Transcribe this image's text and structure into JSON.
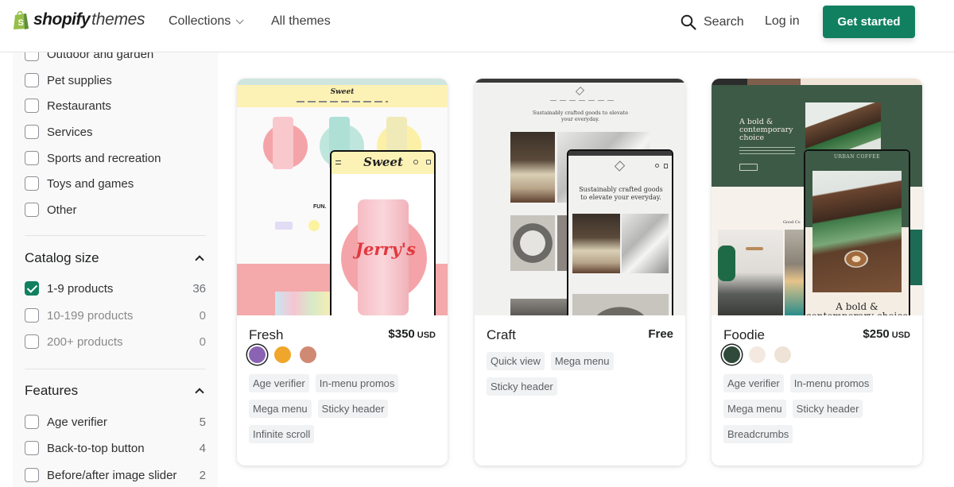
{
  "header": {
    "logo": {
      "bold": "shopify",
      "light": "themes"
    },
    "nav": [
      {
        "label": "Collections",
        "has_dropdown": true
      },
      {
        "label": "All themes"
      }
    ],
    "search_label": "Search",
    "login_label": "Log in",
    "cta_label": "Get started",
    "colors": {
      "accent": "#118060",
      "logo_green": "#95bf47"
    }
  },
  "sidebar": {
    "industry_items": [
      {
        "label": "Outdoor and garden",
        "checked": false
      },
      {
        "label": "Pet supplies",
        "checked": false
      },
      {
        "label": "Restaurants",
        "checked": false
      },
      {
        "label": "Services",
        "checked": false
      },
      {
        "label": "Sports and recreation",
        "checked": false
      },
      {
        "label": "Toys and games",
        "checked": false
      },
      {
        "label": "Other",
        "checked": false
      }
    ],
    "catalog_size": {
      "title": "Catalog size",
      "expanded": true,
      "items": [
        {
          "label": "1-9 products",
          "count": "36",
          "checked": true
        },
        {
          "label": "10-199 products",
          "count": "0",
          "checked": false
        },
        {
          "label": "200+ products",
          "count": "0",
          "checked": false
        }
      ]
    },
    "features": {
      "title": "Features",
      "expanded": true,
      "items": [
        {
          "label": "Age verifier",
          "count": "5",
          "checked": false
        },
        {
          "label": "Back-to-top button",
          "count": "4",
          "checked": false
        },
        {
          "label": "Before/after image slider",
          "count": "2",
          "checked": false
        }
      ]
    }
  },
  "themes": [
    {
      "name": "Fresh",
      "price": "$350",
      "currency": "USD",
      "swatches": [
        "#8a63b5",
        "#f0a62b",
        "#d08a73"
      ],
      "selected_swatch": 0,
      "tags": [
        "Age verifier",
        "In-menu promos",
        "Mega menu",
        "Sticky header",
        "Infinite scroll"
      ],
      "preview": {
        "brand": "Sweet",
        "product": "Jerry's",
        "headline": "FUN."
      }
    },
    {
      "name": "Craft",
      "price": "Free",
      "currency": "",
      "swatches": [],
      "tags": [
        "Quick view",
        "Mega menu",
        "Sticky header"
      ],
      "preview": {
        "headline": "Sustainably crafted goods to elevate your everyday."
      }
    },
    {
      "name": "Foodie",
      "price": "$250",
      "currency": "USD",
      "swatches": [
        "#2f4a3a",
        "#f3e9e1",
        "#efe2d6"
      ],
      "selected_swatch": 0,
      "tags": [
        "Age verifier",
        "In-menu promos",
        "Mega menu",
        "Sticky header",
        "Breadcrumbs"
      ],
      "preview": {
        "brand": "URBAN COFFEE",
        "headline": "A bold & contemporary choice"
      }
    }
  ]
}
